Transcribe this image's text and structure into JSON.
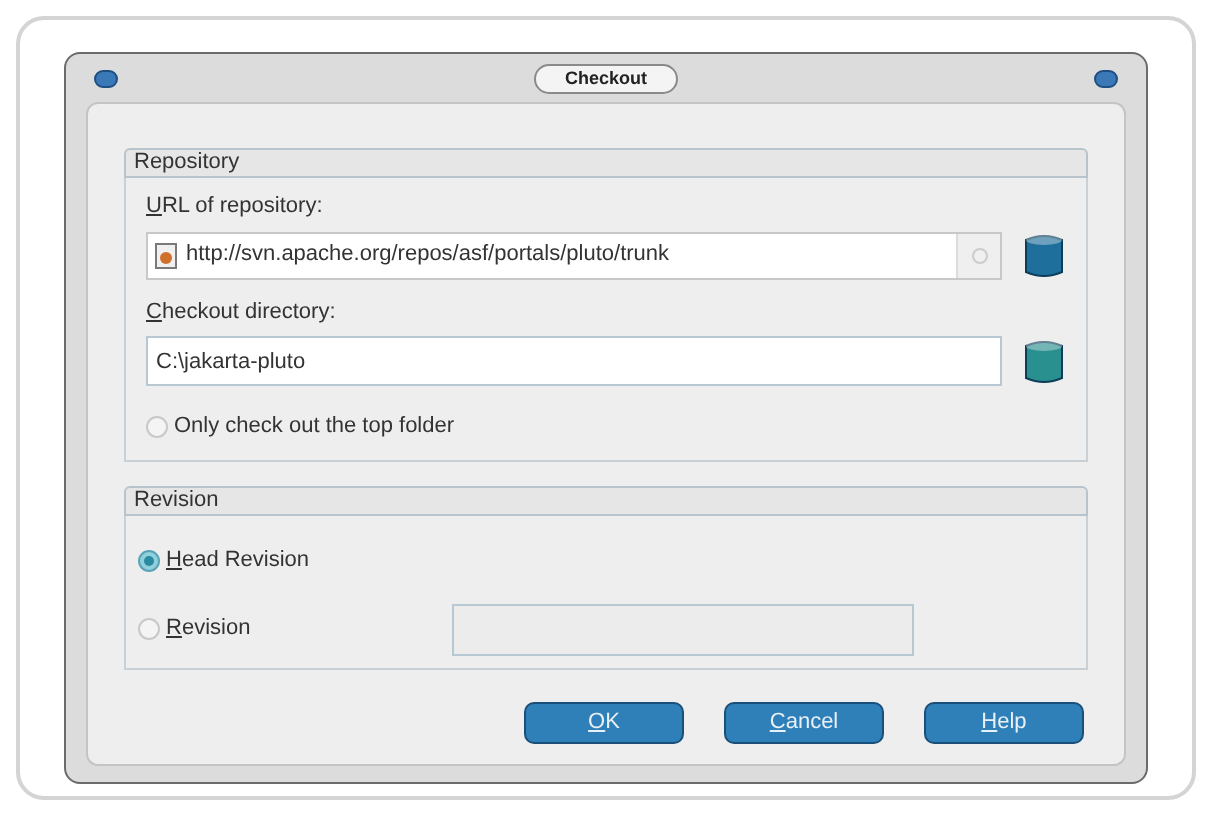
{
  "window": {
    "title": "Checkout"
  },
  "repository": {
    "title": "Repository",
    "url": {
      "label": "URL of repository:",
      "value": "http://svn.apache.org/repos/asf/portals/pluto/trunk"
    },
    "directory": {
      "label": "Checkout directory:",
      "value": "C:\\jakarta-pluto"
    },
    "top_folder_only": {
      "label": "Only check out the top folder",
      "checked": false
    }
  },
  "revision": {
    "title": "Revision",
    "options": [
      {
        "label": "Head Revision",
        "selected": true,
        "kind": "plain"
      },
      {
        "label": "Revision",
        "selected": false,
        "kind": "with_field"
      }
    ]
  },
  "buttons": [
    "OK",
    "Cancel",
    "Help"
  ]
}
